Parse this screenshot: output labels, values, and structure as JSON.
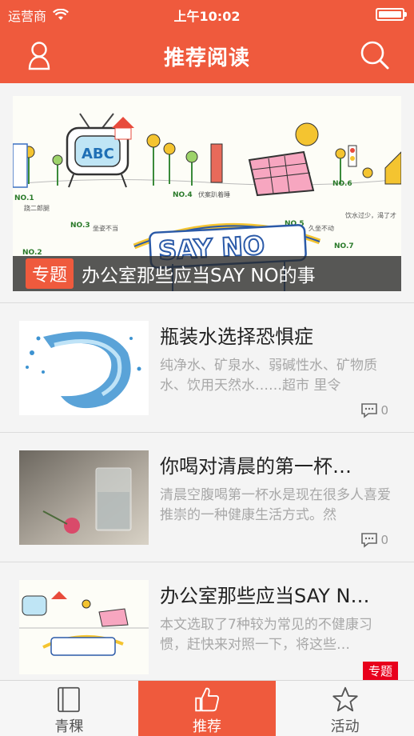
{
  "status_bar": {
    "carrier": "运营商",
    "time": "上午10:02"
  },
  "nav": {
    "title": "推荐阅读",
    "left_icon": "user-icon",
    "right_icon": "search-icon"
  },
  "banner": {
    "tag": "专题",
    "title": "办公室那些应当SAY NO的事",
    "image_text": "SAY NO"
  },
  "articles": [
    {
      "title": "瓶装水选择恐惧症",
      "description": "纯净水、矿泉水、弱碱性水、矿物质水、饮用天然水……超市 里令",
      "comments": "0"
    },
    {
      "title": "你喝对清晨的第一杯…",
      "description": "清晨空腹喝第一杯水是现在很多人喜爱推崇的一种健康生活方式。然",
      "comments": "0"
    },
    {
      "title": "办公室那些应当SAY N…",
      "description": "本文选取了7种较为常见的不健康习惯，赶快来对照一下，将这些…",
      "tag": "专题"
    }
  ],
  "tabs": [
    {
      "label": "青稞",
      "icon": "book-icon"
    },
    {
      "label": "推荐",
      "icon": "thumbs-up-icon",
      "active": true
    },
    {
      "label": "活动",
      "icon": "star-icon"
    }
  ],
  "colors": {
    "brand": "#ef5a3d",
    "special_tag": "#e8001c"
  }
}
